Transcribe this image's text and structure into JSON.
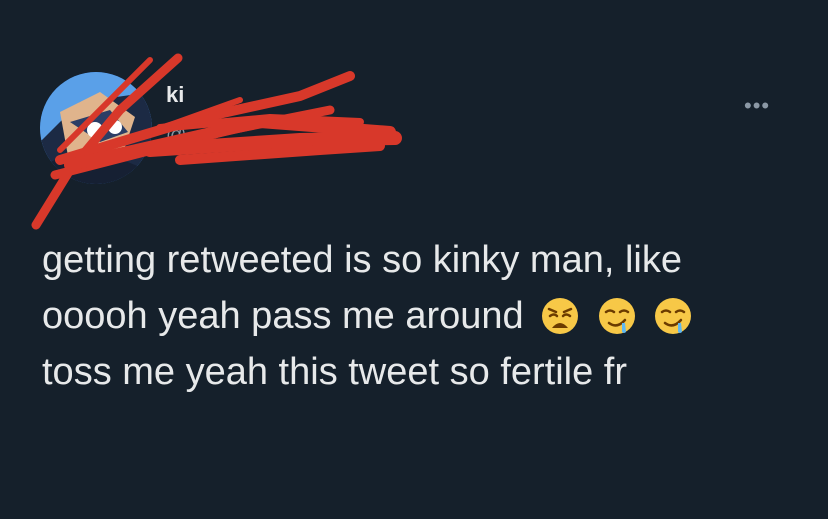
{
  "tweet": {
    "display_name": "ki",
    "handle": "@",
    "more_label": "•••",
    "lines": [
      "getting retweeted is so kinky man, like",
      "ooooh yeah pass me around",
      "toss me yeah this tweet so fertile fr"
    ],
    "emojis": [
      "weary-face-emoji",
      "drooling-face-emoji",
      "drooling-face-emoji"
    ]
  },
  "colors": {
    "background": "#15202b",
    "text": "#e7e9ea",
    "secondary": "#8b98a5",
    "redaction": "#d8382a"
  }
}
